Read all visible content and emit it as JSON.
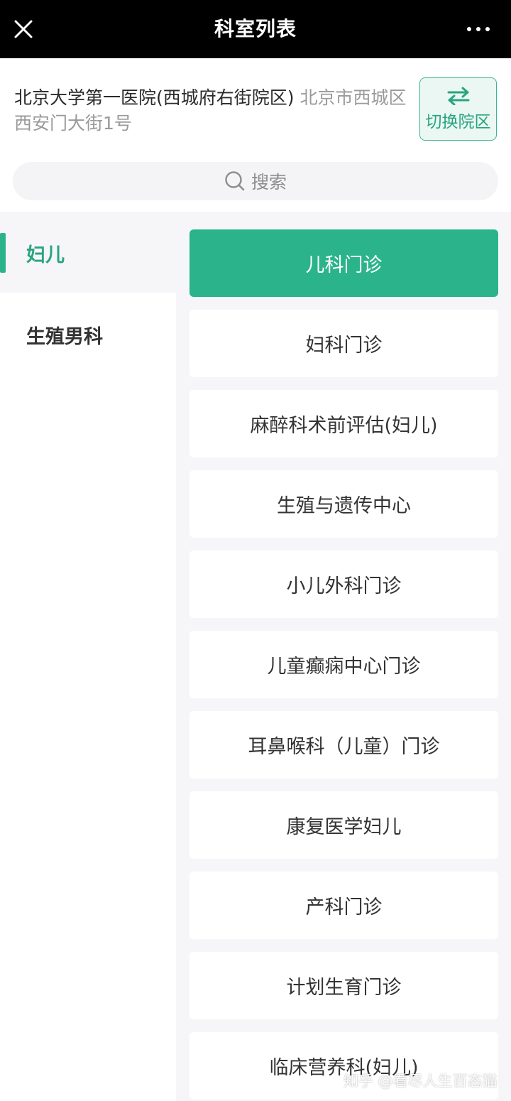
{
  "titlebar": {
    "title": "科室列表",
    "close_icon": "close-icon",
    "more_icon": "more-dots-icon"
  },
  "hospital": {
    "name": "北京大学第一医院(西城府右街院区)",
    "address": "北京市西城区西安门大街1号",
    "switch_label": "切换院区",
    "switch_icon": "swap-arrows-icon"
  },
  "search": {
    "placeholder": "搜索",
    "icon": "search-icon"
  },
  "sidebar": {
    "items": [
      {
        "label": "妇儿",
        "active": true
      },
      {
        "label": "生殖男科",
        "active": false
      }
    ]
  },
  "departments": [
    {
      "label": "儿科门诊",
      "selected": true
    },
    {
      "label": "妇科门诊",
      "selected": false
    },
    {
      "label": "麻醉科术前评估(妇儿)",
      "selected": false
    },
    {
      "label": "生殖与遗传中心",
      "selected": false
    },
    {
      "label": "小儿外科门诊",
      "selected": false
    },
    {
      "label": "儿童癫痫中心门诊",
      "selected": false
    },
    {
      "label": "耳鼻喉科（儿童）门诊",
      "selected": false
    },
    {
      "label": "康复医学妇儿",
      "selected": false
    },
    {
      "label": "产科门诊",
      "selected": false
    },
    {
      "label": "计划生育门诊",
      "selected": false
    },
    {
      "label": "临床营养科(妇儿)",
      "selected": false
    }
  ],
  "watermark": "知乎 @看尽人生百态猫",
  "colors": {
    "accent": "#2bb38b",
    "titlebar_bg": "#000000",
    "address_text": "#9a9a9a"
  }
}
